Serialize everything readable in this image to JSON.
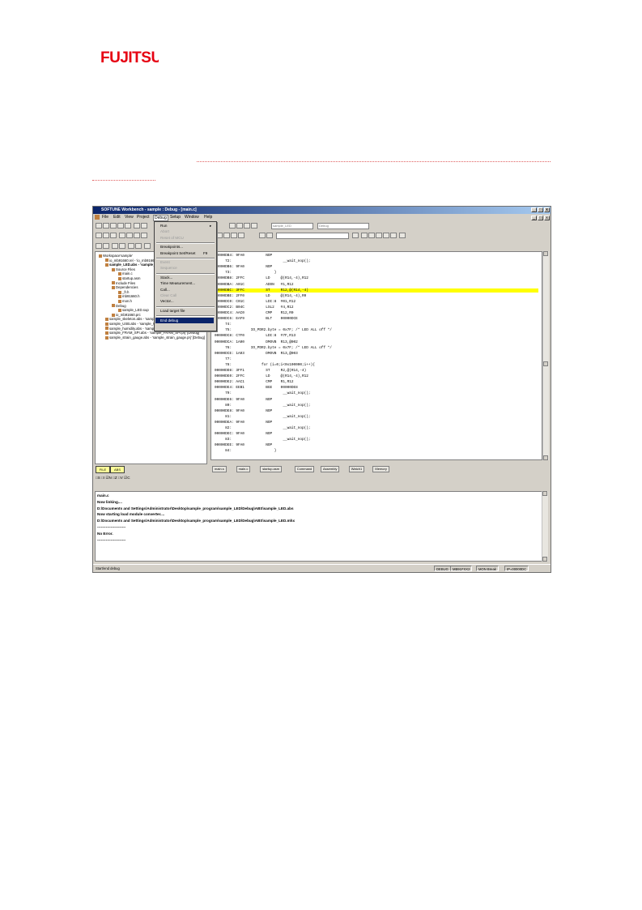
{
  "logo": {
    "text": "FUJITSU",
    "color": "#e60012"
  },
  "window": {
    "title": "SOFTUNE Workbench - sample : Debug - [main.c]",
    "controls": [
      "_",
      "□",
      "x"
    ]
  },
  "menubar": [
    "File",
    "Edit",
    "View",
    "Project",
    "Debug",
    "Setup",
    "Window",
    "Help"
  ],
  "toolbar": {
    "combo_left": "sample_LED",
    "combo_right": "Debug"
  },
  "debug_menu": {
    "items": [
      {
        "label": "Run",
        "enabled": true,
        "submenu": true
      },
      {
        "label": "Abort",
        "enabled": false
      },
      {
        "label": "Reset of MCU",
        "enabled": false
      },
      {
        "label": "Breakpoints...",
        "enabled": true
      },
      {
        "label": "Breakpoint Set/Reset",
        "shortcut": "F9",
        "enabled": true
      },
      {
        "label": "Event",
        "enabled": false
      },
      {
        "label": "Sequence",
        "enabled": false
      },
      {
        "label": "Stack...",
        "enabled": true
      },
      {
        "label": "Time Measurement...",
        "enabled": true
      },
      {
        "label": "Call...",
        "enabled": true
      },
      {
        "label": "Clear Call",
        "enabled": false
      },
      {
        "label": "Vector...",
        "enabled": true
      },
      {
        "label": "Load target file",
        "enabled": true
      },
      {
        "label": "End debug",
        "enabled": true,
        "highlighted": true
      }
    ]
  },
  "project_tree": [
    {
      "label": "Workspace'sample'",
      "level": 0
    },
    {
      "label": "io_mb91660.rel - 'io_mb91660.prj' [Debug]",
      "level": 1
    },
    {
      "label": "sample_LED.abs - 'sample_LED.prj' [Debug]",
      "level": 1,
      "bold": true
    },
    {
      "label": "Source Files",
      "level": 2
    },
    {
      "label": "main.c",
      "level": 3
    },
    {
      "label": "startup.asm",
      "level": 3
    },
    {
      "label": "Include Files",
      "level": 2
    },
    {
      "label": "Dependencies",
      "level": 2
    },
    {
      "label": "_fr.h",
      "level": 3
    },
    {
      "label": "mb91660.h",
      "level": 3
    },
    {
      "label": "mon.h",
      "level": 3
    },
    {
      "label": "Debug",
      "level": 2
    },
    {
      "label": "sample_LED.sup",
      "level": 3
    },
    {
      "label": "io_mb91660.prc",
      "level": 2
    },
    {
      "label": "sample_skeleton.abs - 'sample_skeleton.prj' [Debug]",
      "level": 1
    },
    {
      "label": "sample_USB.abs - 'sample_USB.prj' [Debug]",
      "level": 1
    },
    {
      "label": "sample_humidity.abs - 'sample_humidity.prj' [Debug]",
      "level": 1
    },
    {
      "label": "sample_FRAM_SPI.abs - 'sample_FRAM_SPI.prj' [Debug]",
      "level": 1
    },
    {
      "label": "sample_strain_gauge.abs - 'sample_strain_gauge.prj' [Debug]",
      "level": 1
    }
  ],
  "tree_tabs": [
    "FILE",
    "ABS"
  ],
  "flags_row": "□S □I ☑N □Z □V ☑C",
  "code_lines": [
    {
      "text": "00000DB4: 9FA0          NOP",
      "hl": false
    },
    {
      "text": "     72:                        __wait_nop();",
      "hl": false
    },
    {
      "text": "00000DB6: 9FA0          NOP",
      "hl": false
    },
    {
      "text": "     73:                    }",
      "hl": false
    },
    {
      "text": "00000DB8: 2FFC          LD     @(R14,-4),R12",
      "hl": false
    },
    {
      "text": "00000DBA: A01C          ADDN   #1,R12",
      "hl": false
    },
    {
      "text": "00000DBC: 3FFC          ST     R12,@(R14,-4)",
      "hl": true
    },
    {
      "text": "00000DBE: 2FF0          LD     @(R14,-4),R0",
      "hl": false
    },
    {
      "text": "00000DC0: C01C          LDI:8  #01,R12",
      "hl": false
    },
    {
      "text": "00000DC2: B04C          LSL2   #4,R12",
      "hl": false
    },
    {
      "text": "00000DC4: AAC0          CMP    R12,R0",
      "hl": false
    },
    {
      "text": "00000DC6: EAF9          BLT    00000DCE",
      "hl": false
    },
    {
      "text": "     74:",
      "hl": false
    },
    {
      "text": "     75:         IO_PDR2.byte = 0x7F; /* LED ALL off */",
      "hl": false
    },
    {
      "text": "00000DC8: C7F0          LDI:8  #7F,R13",
      "hl": false
    },
    {
      "text": "00000DCA: 1A00          DMOVB  R13,@002",
      "hl": false
    },
    {
      "text": "     76:         IO_PDR2.byte = 0x7F; /* LED ALL off */",
      "hl": false
    },
    {
      "text": "00000DCE: 1A03          DMOVB  R13,@003",
      "hl": false
    },
    {
      "text": "     77:",
      "hl": false
    },
    {
      "text": "     78:              for (i=0;i<0x100000;i++){",
      "hl": false
    },
    {
      "text": "00000DD8: 3FF1          ST     R2,@(R14,-4)",
      "hl": false
    },
    {
      "text": "00000DE0: 2FFC          LD     @(R14,-4),R12",
      "hl": false
    },
    {
      "text": "00000DE2: AAC1          CMP    R1,R12",
      "hl": false
    },
    {
      "text": "00000DE4: EEB1          BGE    00000DE8",
      "hl": false
    },
    {
      "text": "     79:                        __wait_nop();",
      "hl": false
    },
    {
      "text": "00000DE6: 9FA0          NOP",
      "hl": false
    },
    {
      "text": "     80:                        __wait_nop();",
      "hl": false
    },
    {
      "text": "00000DE8: 9FA0          NOP",
      "hl": false
    },
    {
      "text": "     81:                        __wait_nop();",
      "hl": false
    },
    {
      "text": "00000DEA: 9FA0          NOP",
      "hl": false
    },
    {
      "text": "     82:                        __wait_nop();",
      "hl": false
    },
    {
      "text": "00000DEC: 9FA0          NOP",
      "hl": false
    },
    {
      "text": "     83:                        __wait_nop();",
      "hl": false
    },
    {
      "text": "00000DEE: 9FA0          NOP",
      "hl": false
    },
    {
      "text": "     84:                    }",
      "hl": false
    }
  ],
  "editor_tabs": [
    "main.s",
    "main.c",
    "startup.asm",
    "Command",
    "Assembly",
    "Watch1",
    "Memory"
  ],
  "output_lines": [
    "main.c",
    "Now linking....",
    "D:\\Documents and Settings\\Administrator\\Desktop\\sample_program\\sample_LED\\Debug\\ABS\\sample_LED.abs",
    "Now starting load module converter....",
    "D:\\Documents and Settings\\Administrator\\Desktop\\sample_program\\sample_LED\\Debug\\ABS\\sample_LED.mhx",
    "-----------------------",
    "No Error.",
    "-----------------------"
  ],
  "status": {
    "left": "Start/end debug",
    "cells": [
      "DEBUG",
      "MB91FXX2",
      "MON Break",
      "IP=00000DC"
    ]
  }
}
